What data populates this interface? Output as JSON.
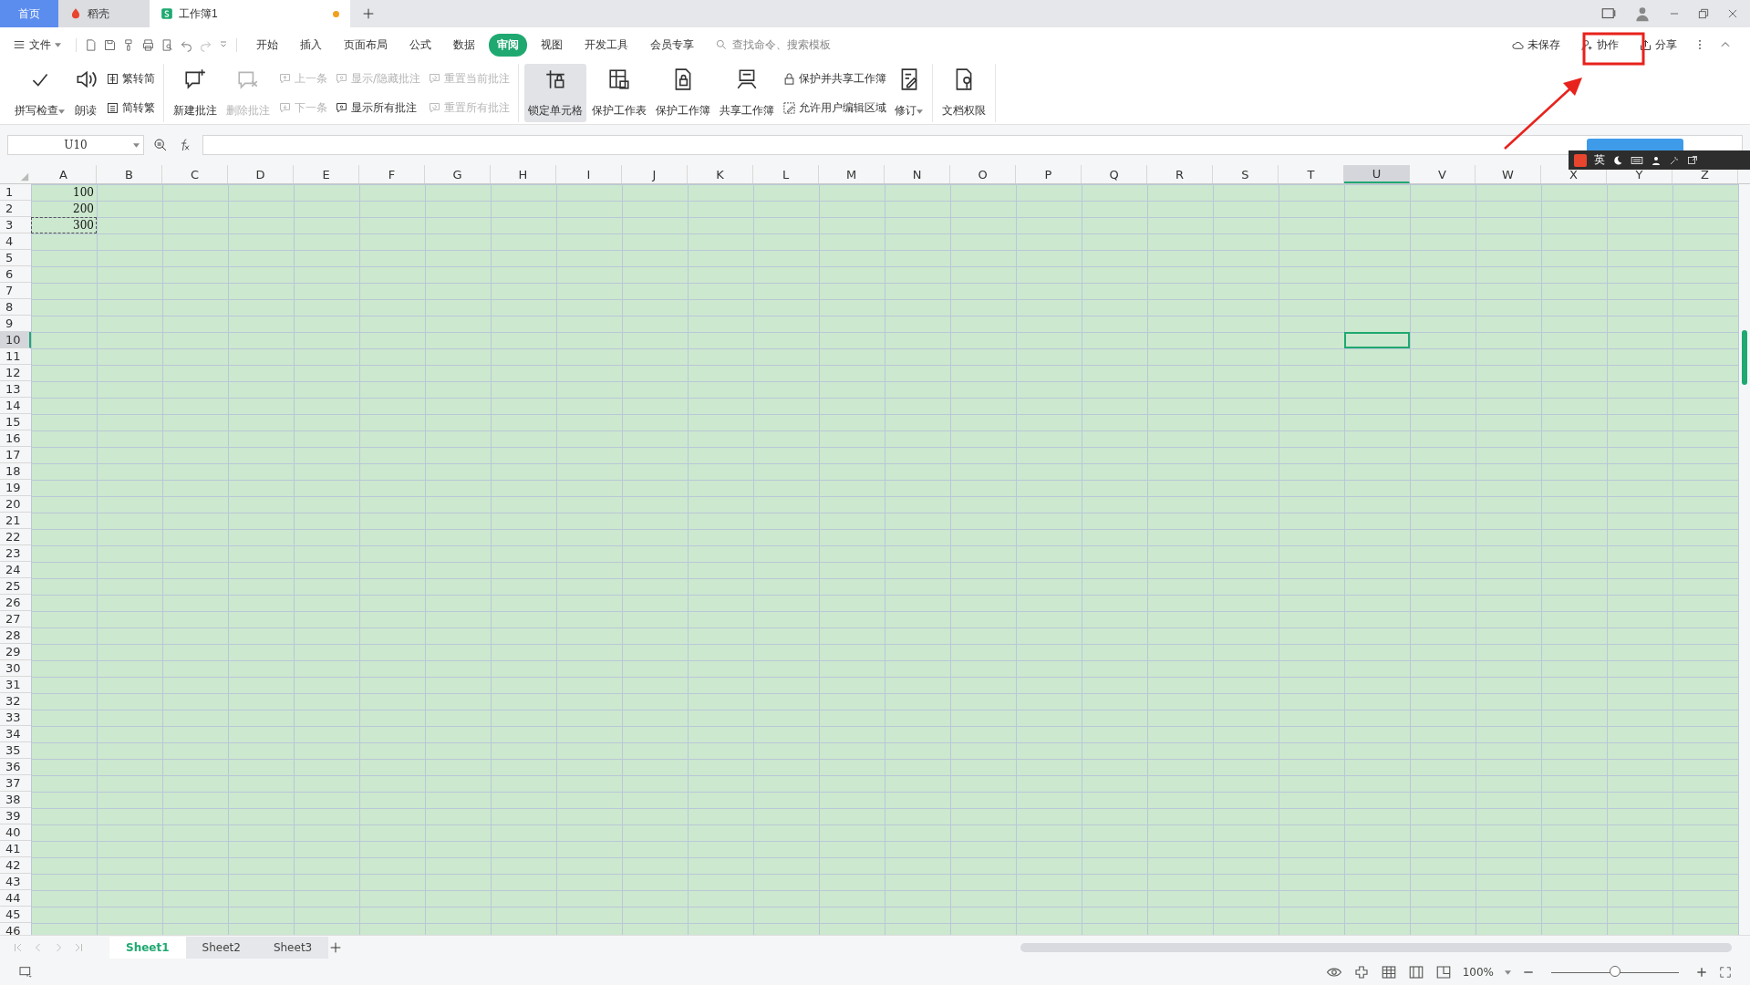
{
  "app_tabs": [
    {
      "label": "首页",
      "kind": "home",
      "selected": false
    },
    {
      "label": "稻壳",
      "kind": "docer",
      "selected": false
    },
    {
      "label": "工作簿1",
      "kind": "sheet",
      "selected": true,
      "unsaved": true
    }
  ],
  "menu": {
    "file": "文件",
    "tabs": [
      {
        "label": "开始",
        "selected": false
      },
      {
        "label": "插入",
        "selected": false
      },
      {
        "label": "页面布局",
        "selected": false
      },
      {
        "label": "公式",
        "selected": false
      },
      {
        "label": "数据",
        "selected": false
      },
      {
        "label": "审阅",
        "selected": true
      },
      {
        "label": "视图",
        "selected": false
      },
      {
        "label": "开发工具",
        "selected": false
      },
      {
        "label": "会员专享",
        "selected": false
      }
    ],
    "search": {
      "placeholder": "查找命令、搜索模板"
    },
    "save_status": "未保存",
    "collaborate": "协作",
    "share": "分享"
  },
  "ribbon": {
    "groups": [
      {
        "items": [
          {
            "label": "拼写检查",
            "kind": "large",
            "disabled": false,
            "pressed": false,
            "dropdown": true
          },
          {
            "label": "朗读",
            "kind": "large",
            "disabled": false,
            "pressed": false,
            "dropdown": false
          },
          {
            "label": "繁转简",
            "kind": "small",
            "disabled": false,
            "pressed": false,
            "dropdown": false
          },
          {
            "label": "简转繁",
            "kind": "small",
            "disabled": false,
            "pressed": false,
            "dropdown": false
          }
        ]
      },
      {
        "items": [
          {
            "label": "新建批注",
            "kind": "large",
            "disabled": false,
            "pressed": false,
            "dropdown": false
          },
          {
            "label": "删除批注",
            "kind": "large",
            "disabled": true,
            "pressed": false,
            "dropdown": false
          },
          {
            "label": "上一条",
            "kind": "small",
            "disabled": true,
            "pressed": false,
            "dropdown": false
          },
          {
            "label": "下一条",
            "kind": "small",
            "disabled": true,
            "pressed": false,
            "dropdown": false
          },
          {
            "label": "显示/隐藏批注",
            "kind": "small",
            "disabled": true,
            "pressed": false,
            "dropdown": false
          },
          {
            "label": "显示所有批注",
            "kind": "small",
            "disabled": false,
            "pressed": false,
            "dropdown": false
          },
          {
            "label": "重置当前批注",
            "kind": "small",
            "disabled": true,
            "pressed": false,
            "dropdown": false
          },
          {
            "label": "重置所有批注",
            "kind": "small",
            "disabled": true,
            "pressed": false,
            "dropdown": false
          }
        ]
      },
      {
        "items": [
          {
            "label": "锁定单元格",
            "kind": "large",
            "disabled": false,
            "pressed": true,
            "dropdown": false
          },
          {
            "label": "保护工作表",
            "kind": "large",
            "disabled": false,
            "pressed": false,
            "dropdown": false
          },
          {
            "label": "保护工作簿",
            "kind": "large",
            "disabled": false,
            "pressed": false,
            "dropdown": false
          },
          {
            "label": "共享工作簿",
            "kind": "large",
            "disabled": false,
            "pressed": false,
            "dropdown": false
          },
          {
            "label": "保护并共享工作簿",
            "kind": "small",
            "disabled": false,
            "pressed": false,
            "dropdown": false
          },
          {
            "label": "允许用户编辑区域",
            "kind": "small",
            "disabled": false,
            "pressed": false,
            "dropdown": false
          },
          {
            "label": "修订",
            "kind": "large",
            "disabled": false,
            "pressed": false,
            "dropdown": true
          }
        ]
      },
      {
        "items": [
          {
            "label": "文档权限",
            "kind": "large",
            "disabled": false,
            "pressed": false,
            "dropdown": false
          }
        ]
      }
    ]
  },
  "name_box": "U10",
  "ime_bar": {
    "mode": "英"
  },
  "columns": [
    {
      "label": "A",
      "selected": false
    },
    {
      "label": "B",
      "selected": false
    },
    {
      "label": "C",
      "selected": false
    },
    {
      "label": "D",
      "selected": false
    },
    {
      "label": "E",
      "selected": false
    },
    {
      "label": "F",
      "selected": false
    },
    {
      "label": "G",
      "selected": false
    },
    {
      "label": "H",
      "selected": false
    },
    {
      "label": "I",
      "selected": false
    },
    {
      "label": "J",
      "selected": false
    },
    {
      "label": "K",
      "selected": false
    },
    {
      "label": "L",
      "selected": false
    },
    {
      "label": "M",
      "selected": false
    },
    {
      "label": "N",
      "selected": false
    },
    {
      "label": "O",
      "selected": false
    },
    {
      "label": "P",
      "selected": false
    },
    {
      "label": "Q",
      "selected": false
    },
    {
      "label": "R",
      "selected": false
    },
    {
      "label": "S",
      "selected": false
    },
    {
      "label": "T",
      "selected": false
    },
    {
      "label": "U",
      "selected": true
    },
    {
      "label": "V",
      "selected": false
    },
    {
      "label": "W",
      "selected": false
    },
    {
      "label": "X",
      "selected": false
    },
    {
      "label": "Y",
      "selected": false
    },
    {
      "label": "Z",
      "selected": false
    }
  ],
  "rows": [
    {
      "label": "1",
      "selected": false,
      "cells": [
        {
          "value": "100",
          "marquee": false
        }
      ]
    },
    {
      "label": "2",
      "selected": false,
      "cells": [
        {
          "value": "200",
          "marquee": false
        }
      ]
    },
    {
      "label": "3",
      "selected": false,
      "cells": [
        {
          "value": "300",
          "marquee": true
        }
      ]
    },
    {
      "label": "4",
      "selected": false
    },
    {
      "label": "5",
      "selected": false
    },
    {
      "label": "6",
      "selected": false
    },
    {
      "label": "7",
      "selected": false
    },
    {
      "label": "8",
      "selected": false
    },
    {
      "label": "9",
      "selected": false
    },
    {
      "label": "10",
      "selected": true
    },
    {
      "label": "11",
      "selected": false
    },
    {
      "label": "12",
      "selected": false
    },
    {
      "label": "13",
      "selected": false
    },
    {
      "label": "14",
      "selected": false
    },
    {
      "label": "15",
      "selected": false
    },
    {
      "label": "16",
      "selected": false
    },
    {
      "label": "17",
      "selected": false
    },
    {
      "label": "18",
      "selected": false
    },
    {
      "label": "19",
      "selected": false
    },
    {
      "label": "20",
      "selected": false
    },
    {
      "label": "21",
      "selected": false
    },
    {
      "label": "22",
      "selected": false
    },
    {
      "label": "23",
      "selected": false
    },
    {
      "label": "24",
      "selected": false
    },
    {
      "label": "25",
      "selected": false
    },
    {
      "label": "26",
      "selected": false
    },
    {
      "label": "27",
      "selected": false
    },
    {
      "label": "28",
      "selected": false
    },
    {
      "label": "29",
      "selected": false
    },
    {
      "label": "30",
      "selected": false
    },
    {
      "label": "31",
      "selected": false
    },
    {
      "label": "32",
      "selected": false
    },
    {
      "label": "33",
      "selected": false
    },
    {
      "label": "34",
      "selected": false
    },
    {
      "label": "35",
      "selected": false
    },
    {
      "label": "36",
      "selected": false
    },
    {
      "label": "37",
      "selected": false
    },
    {
      "label": "38",
      "selected": false
    },
    {
      "label": "39",
      "selected": false
    },
    {
      "label": "40",
      "selected": false
    },
    {
      "label": "41",
      "selected": false
    },
    {
      "label": "42",
      "selected": false
    },
    {
      "label": "43",
      "selected": false
    },
    {
      "label": "44",
      "selected": false
    },
    {
      "label": "45",
      "selected": false
    },
    {
      "label": "46",
      "selected": false
    }
  ],
  "sheet_tabs": [
    {
      "label": "Sheet1",
      "selected": true
    },
    {
      "label": "Sheet2",
      "selected": false
    },
    {
      "label": "Sheet3",
      "selected": false
    }
  ],
  "status_bar": {
    "zoom": "100%",
    "zoom_slider": {
      "level": 0.5
    }
  }
}
